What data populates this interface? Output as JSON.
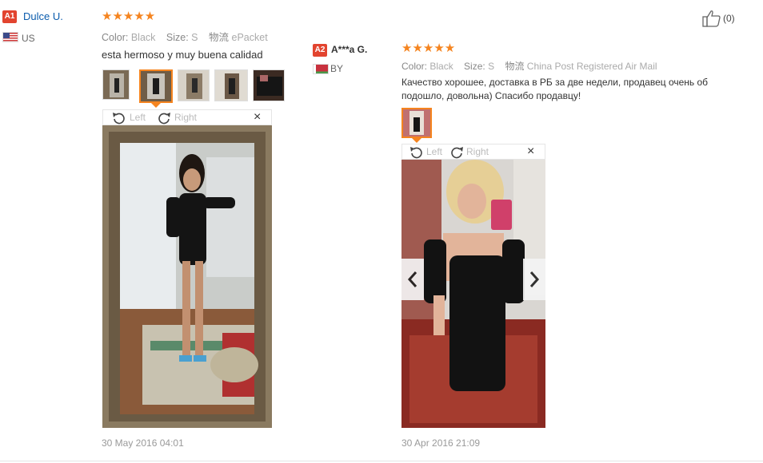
{
  "review1": {
    "badge": "A1",
    "name": "Dulce U.",
    "country": "US",
    "stars": "★★★★★",
    "color_label": "Color:",
    "color_value": "Black",
    "size_label": "Size:",
    "size_value": "S",
    "shipping_label": "物流",
    "shipping_value": "ePacket",
    "text": "esta hermoso y muy buena calidad",
    "rotate_left": "Left",
    "rotate_right": "Right",
    "close": "×",
    "date": "30 May 2016 04:01",
    "like_count": "(0)"
  },
  "review2": {
    "badge": "A2",
    "name": "A***a G.",
    "country": "BY",
    "stars": "★★★★★",
    "color_label": "Color:",
    "color_value": "Black",
    "size_label": "Size:",
    "size_value": "S",
    "shipping_label": "物流",
    "shipping_value": "China Post Registered Air Mail",
    "text": "Качество хорошее, доставка в РБ за две недели, продавец очень об подошло, довольна) Спасибо продавцу!",
    "rotate_left": "Left",
    "rotate_right": "Right",
    "close": "×",
    "date": "30 Apr 2016 21:09"
  },
  "icons": {
    "like": "thumbs-up-icon",
    "rotate_left": "rotate-left-icon",
    "rotate_right": "rotate-right-icon",
    "prev": "chevron-left-icon",
    "next": "chevron-right-icon"
  },
  "colors": {
    "badge": "#e2442f",
    "name_link": "#0b5cad",
    "star": "#f5841f",
    "selected_border": "#f5841f"
  }
}
